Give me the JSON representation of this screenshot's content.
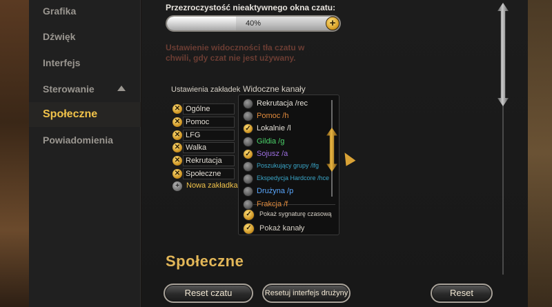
{
  "nav": {
    "items": [
      {
        "label": "Grafika"
      },
      {
        "label": "Dźwięk"
      },
      {
        "label": "Interfejs"
      },
      {
        "label": "Sterowanie"
      },
      {
        "label": "Społeczne"
      },
      {
        "label": "Powiadomienia"
      }
    ],
    "active": "Społeczne"
  },
  "opacity": {
    "label": "Przezroczystość nieaktywnego okna czatu:",
    "value_text": "40%",
    "value": 0.4,
    "minus": "−",
    "plus": "+"
  },
  "hint": "Ustawienie widoczności tła czatu w chwili, gdy czat nie jest używany.",
  "tabs": {
    "header": "Ustawienia zakładek",
    "items": [
      {
        "label": "Ogólne"
      },
      {
        "label": "Pomoc"
      },
      {
        "label": "LFG"
      },
      {
        "label": "Walka"
      },
      {
        "label": "Rekrutacja"
      },
      {
        "label": "Społeczne"
      }
    ],
    "new_tab": "Nowa zakładka",
    "remove_glyph": "✕"
  },
  "channels": {
    "header": "Widoczne kanały",
    "items": [
      {
        "label": "Rekrutacja /rec",
        "checked": false,
        "color": "#e6e2da"
      },
      {
        "label": "Pomoc /h",
        "checked": false,
        "color": "#e08a3c"
      },
      {
        "label": "Lokalnie /l",
        "checked": true,
        "color": "#e6e2da"
      },
      {
        "label": "Gildia /g",
        "checked": false,
        "color": "#4bd36a"
      },
      {
        "label": "Sojusz /a",
        "checked": true,
        "color": "#9d6fe0"
      },
      {
        "label": "Poszukujący grupy /lfg",
        "checked": false,
        "color": "#3aa6c8"
      },
      {
        "label": "Ekspedycja Hardcore /hce",
        "checked": false,
        "color": "#3aa6c8"
      },
      {
        "label": "Drużyna /p",
        "checked": false,
        "color": "#5aa8ff"
      },
      {
        "label": "Frakcja /f",
        "checked": false,
        "color": "#e08a3c"
      }
    ],
    "check_glyph": "✓",
    "options": [
      {
        "label": "Pokaż sygnaturę czasową",
        "checked": true
      },
      {
        "label": "Pokaż kanały",
        "checked": true
      }
    ]
  },
  "section_title": "Społeczne",
  "buttons": {
    "reset_chat": "Reset czatu",
    "reset_party": "Resetuj interfejs drużyny",
    "reset": "Reset"
  }
}
